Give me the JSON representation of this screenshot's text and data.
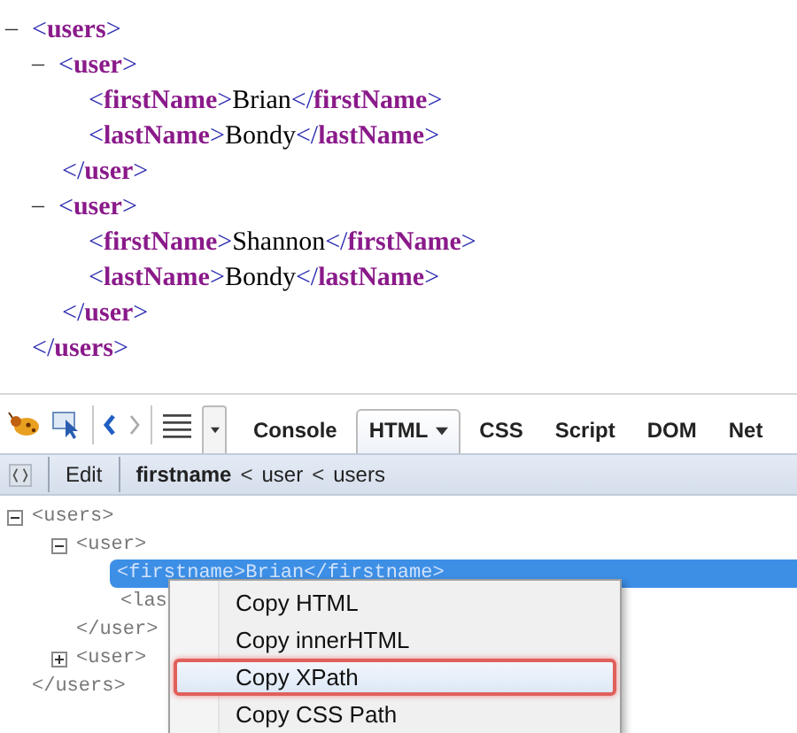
{
  "xml_view": {
    "nodes": [
      {
        "toggle": "–",
        "start": "<",
        "name": "users",
        "end": ">",
        "children": [
          {
            "toggle": "–",
            "start": "<",
            "name": "user",
            "end": ">",
            "children": [
              {
                "start": "<",
                "name": "firstName",
                "end": ">",
                "value": "Brian",
                "closing": {
                  "start": "</",
                  "name": "firstName",
                  "end": ">"
                }
              },
              {
                "start": "<",
                "name": "lastName",
                "end": ">",
                "value": "Bondy",
                "closing": {
                  "start": "</",
                  "name": "lastName",
                  "end": ">"
                }
              }
            ],
            "closing": {
              "start": "</",
              "name": "user",
              "end": ">"
            }
          },
          {
            "toggle": "–",
            "start": "<",
            "name": "user",
            "end": ">",
            "children": [
              {
                "start": "<",
                "name": "firstName",
                "end": ">",
                "value": "Shannon",
                "closing": {
                  "start": "</",
                  "name": "firstName",
                  "end": ">"
                }
              },
              {
                "start": "<",
                "name": "lastName",
                "end": ">",
                "value": "Bondy",
                "closing": {
                  "start": "</",
                  "name": "lastName",
                  "end": ">"
                }
              }
            ],
            "closing": {
              "start": "</",
              "name": "user",
              "end": ">"
            }
          }
        ],
        "closing": {
          "start": "</",
          "name": "users",
          "end": ">"
        }
      }
    ]
  },
  "toolbar": {
    "tabs": [
      {
        "label": "Console",
        "selected": false,
        "dropdown": false
      },
      {
        "label": "HTML",
        "selected": true,
        "dropdown": true
      },
      {
        "label": "CSS",
        "selected": false,
        "dropdown": false
      },
      {
        "label": "Script",
        "selected": false,
        "dropdown": false
      },
      {
        "label": "DOM",
        "selected": false,
        "dropdown": false
      },
      {
        "label": "Net",
        "selected": false,
        "dropdown": false
      }
    ]
  },
  "breadcrumb": {
    "edit_button": "Edit",
    "separator": "<",
    "items": [
      {
        "label": "firstname",
        "selected": true
      },
      {
        "label": "user",
        "selected": false
      },
      {
        "label": "users",
        "selected": false
      }
    ]
  },
  "html_tree": {
    "nodes": [
      {
        "text": "<users>",
        "expanded": true,
        "selected": false,
        "children": [
          {
            "text": "<user>",
            "expanded": true,
            "selected": false,
            "children": [
              {
                "text": "<firstname>Brian</firstname>",
                "selected": true
              },
              {
                "text": "<las",
                "selected": false
              }
            ],
            "close": "</user>"
          },
          {
            "text": "<user>",
            "expanded": false,
            "selected": false
          }
        ],
        "close": "</users>"
      }
    ]
  },
  "context_menu": {
    "items": [
      {
        "label": "Copy HTML",
        "selected": false
      },
      {
        "label": "Copy innerHTML",
        "selected": false
      },
      {
        "label": "Copy XPath",
        "selected": true
      },
      {
        "label": "Copy CSS Path",
        "selected": false
      }
    ]
  }
}
